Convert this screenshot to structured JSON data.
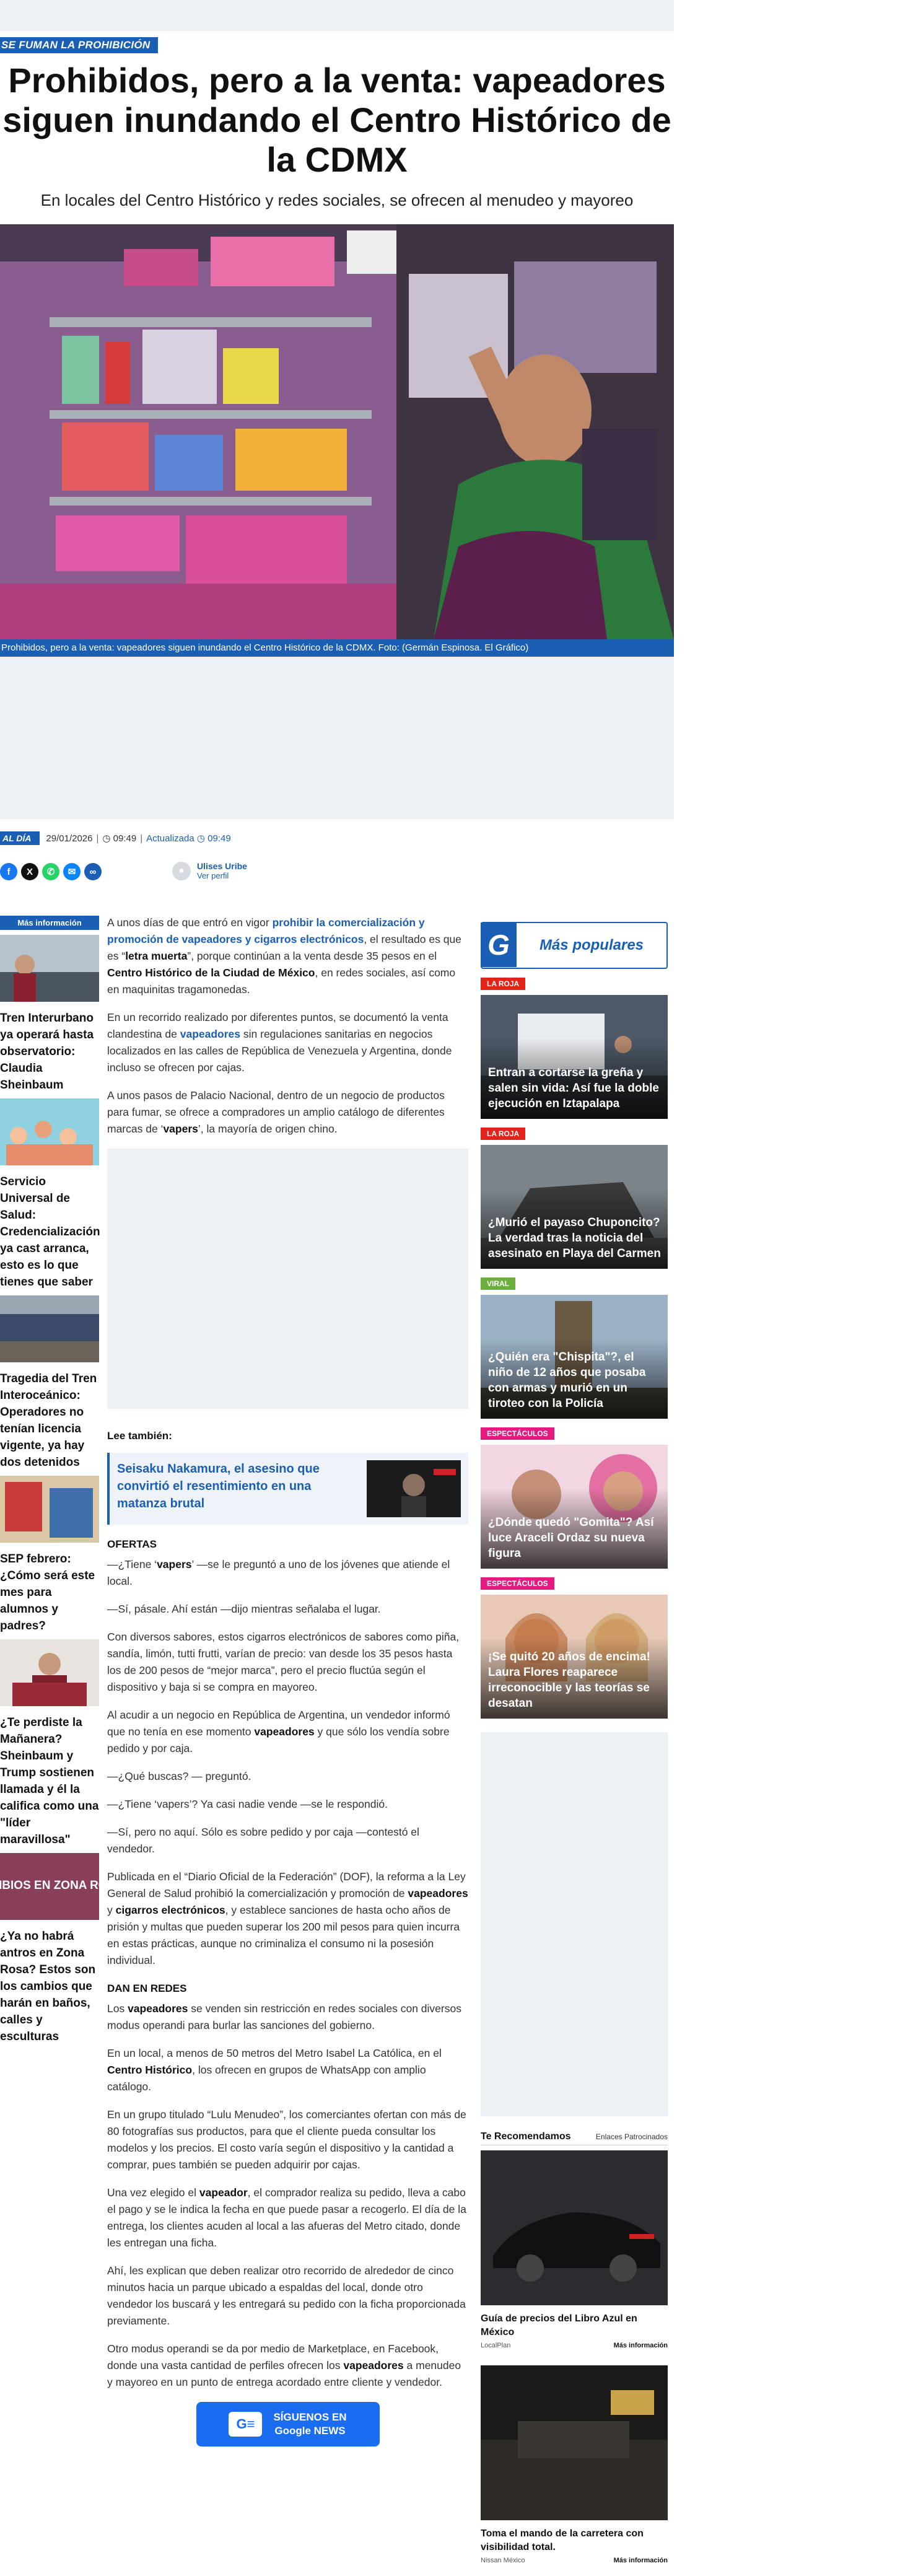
{
  "kicker": "SE FUMAN LA PROHIBICIÓN",
  "headline": "Prohibidos, pero a la venta: vapeadores siguen inundando el Centro Histórico de la CDMX",
  "subtitle": "En locales del Centro Histórico y redes sociales, se ofrecen al menudeo y mayoreo",
  "caption": "Prohibidos, pero a la venta: vapeadores siguen inundando el Centro Histórico de la CDMX. Foto: (Germán Espinosa. El Gráfico)",
  "meta": {
    "section": "AL DÍA",
    "date": "29/01/2026",
    "time": "09:49",
    "updated_label": "Actualizada",
    "updated_time": "09:49"
  },
  "author": {
    "name": "Ulises Uribe",
    "profile_label": "Ver perfil"
  },
  "left_column": {
    "header": "Más información",
    "items": [
      {
        "title": "Tren Interurbano ya operará hasta observatorio: Claudia Sheinbaum"
      },
      {
        "title": "Servicio Universal de Salud: Credencialización ya cast arranca, esto es lo que tienes que saber"
      },
      {
        "title": "Tragedia del Tren Interoceánico: Operadores no tenían licencia vigente, ya hay dos detenidos"
      },
      {
        "title": "SEP febrero: ¿Cómo será este mes para alumnos y padres?"
      },
      {
        "title": "¿Te perdiste la Mañanera? Sheinbaum y Trump sostienen llamada y él la califica como una \"líder maravillosa\""
      },
      {
        "title": "¿Ya no habrá antros en Zona Rosa? Estos son los cambios que harán en baños, calles y esculturas",
        "image_text": "CAMBIOS EN ZONA ROSA"
      }
    ]
  },
  "article": {
    "p1_a": "A unos días de que entró en vigor ",
    "p1_link": "prohibir la comercialización y promoción de vapeadores y cigarros electrónicos",
    "p1_b": ", el resultado es que es “",
    "p1_bold1": "letra muerta",
    "p1_c": "”, porque continúan a la venta desde 35 pesos en el ",
    "p1_bold2": "Centro Histórico de la Ciudad de México",
    "p1_d": ", en redes sociales, así como en maquinitas tragamonedas.",
    "p2_a": "En un recorrido realizado por diferentes puntos, se documentó la venta clandestina de ",
    "p2_link": "vapeadores",
    "p2_b": " sin regulaciones sanitarias en negocios localizados en las calles de República de Venezuela y Argentina, donde incluso se ofrecen por cajas.",
    "p3_a": "A unos pasos de Palacio Nacional, dentro de un negocio de productos para fumar, se ofrece a compradores un amplio catálogo de diferentes marcas de ‘",
    "p3_bold": "vapers",
    "p3_b": "’, la mayoría de origen chino.",
    "see_also_label": "Lee también:",
    "related_title": "Seisaku Nakamura, el asesino que convirtió el resentimiento en una matanza brutal",
    "section1": "OFERTAS",
    "p4_a": "—¿Tiene ‘",
    "p4_bold": "vapers",
    "p4_b": "’ —se le preguntó a uno de los jóvenes que atiende el local.",
    "p5": "—Sí, pásale. Ahí están —dijo mientras señalaba el lugar.",
    "p6": "Con diversos sabores, estos cigarros electrónicos de sabores como piña, sandía, limón, tutti frutti, varían de precio: van desde los 35 pesos hasta los de 200 pesos de “mejor marca”, pero el precio fluctúa según el dispositivo y baja si se compra en mayoreo.",
    "p7_a": "Al acudir a un negocio en República de Argentina, un vendedor informó que no tenía en ese momento ",
    "p7_bold": "vapeadores",
    "p7_b": " y que sólo los vendía sobre pedido y por caja.",
    "p8": "—¿Qué buscas? — preguntó.",
    "p9": "—¿Tiene ‘vapers’? Ya casi nadie vende —se le respondió.",
    "p10": "—Sí, pero no aquí. Sólo es sobre pedido y por caja —contestó el vendedor.",
    "p11_a": "Publicada en el “Diario Oficial de la Federación” (DOF), la reforma a la Ley General de Salud prohibió la comercialización y promoción de ",
    "p11_bold1": "vapeadores",
    "p11_b": " y ",
    "p11_bold2": "cigarros electrónicos",
    "p11_c": ", y establece sanciones de hasta ocho años de prisión y multas que pueden superar los 200 mil pesos para quien incurra en estas prácticas, aunque no criminaliza el consumo ni la posesión individual.",
    "section2": "DAN EN REDES",
    "p12_a": "Los ",
    "p12_bold": "vapeadores",
    "p12_b": " se venden sin restricción en redes sociales con diversos modus operandi para burlar las sanciones del gobierno.",
    "p13_a": "En un local, a menos de 50 metros del Metro Isabel La Católica, en el ",
    "p13_bold": "Centro Histórico",
    "p13_b": ", los ofrecen en grupos de WhatsApp con amplio catálogo.",
    "p14": "En un grupo titulado “Lulu Menudeo”, los comerciantes ofertan con más de 80 fotografías sus productos, para que el cliente pueda consultar los modelos y los precios. El costo varía según el dispositivo y la cantidad a comprar, pues también se pueden adquirir por cajas.",
    "p15_a": "Una vez elegido el ",
    "p15_bold": "vapeador",
    "p15_b": ", el comprador realiza su pedido, lleva a cabo el pago y se le indica la fecha en que puede pasar a recogerlo. El día de la entrega, los clientes acuden al local a las afueras del Metro citado, donde les entregan una ficha.",
    "p16": "Ahí, les explican que deben realizar otro recorrido de alrededor de cinco minutos hacia un parque ubicado a espaldas del local, donde otro vendedor los buscará y les entregará su pedido con la ficha proporcionada previamente.",
    "p17_a": "Otro modus operandi se da por medio de Marketplace, en Facebook, donde una vasta cantidad de perfiles ofrecen los ",
    "p17_bold": "vapeadores",
    "p17_b": " a menudeo y mayoreo en un punto de entrega acordado entre cliente y vendedor.",
    "gnews_line1": "SÍGUENOS EN",
    "gnews_line2": "Google NEWS"
  },
  "right_column": {
    "logo_letter": "G",
    "header": "Más populares",
    "items": [
      {
        "tag": "LA ROJA",
        "tag_color": "#e2231a",
        "title": "Entran a cortarse la greña y salen sin vida: Así fue la doble ejecución en Iztapalapa"
      },
      {
        "tag": "LA ROJA",
        "tag_color": "#e2231a",
        "title": "¿Murió el payaso Chuponcito? La verdad tras la noticia del asesinato en Playa del Carmen"
      },
      {
        "tag": "VIRAL",
        "tag_color": "#6cae3e",
        "title": "¿Quién era \"Chispita\"?, el niño de 12 años que posaba con armas y murió en un tiroteo con la Policía"
      },
      {
        "tag": "ESPECTÁCULOS",
        "tag_color": "#e5197f",
        "title": "¿Dónde quedó \"Gomita\"? Así luce Araceli Ordaz su nueva figura"
      },
      {
        "tag": "ESPECTÁCULOS",
        "tag_color": "#e5197f",
        "title": "¡Se quitó 20 años de encima! Laura Flores reaparece irreconocible y las teorías se desatan"
      }
    ],
    "recs_header": "Te Recomendamos",
    "recs_sponsored": "Enlaces Patrocinados",
    "recs": [
      {
        "title": "Guía de precios del Libro Azul en México",
        "source": "LocalPlan",
        "more": "Más información"
      },
      {
        "title": "Toma el mando de la carretera con visibilidad total.",
        "source": "Nissan México",
        "more": "Más información"
      }
    ]
  },
  "colors": {
    "brand_blue": "#1a5fb4",
    "placeholder_gray": "#eef1f4",
    "roja": "#e2231a",
    "viral": "#6cae3e",
    "espectaculos": "#e5197f"
  }
}
